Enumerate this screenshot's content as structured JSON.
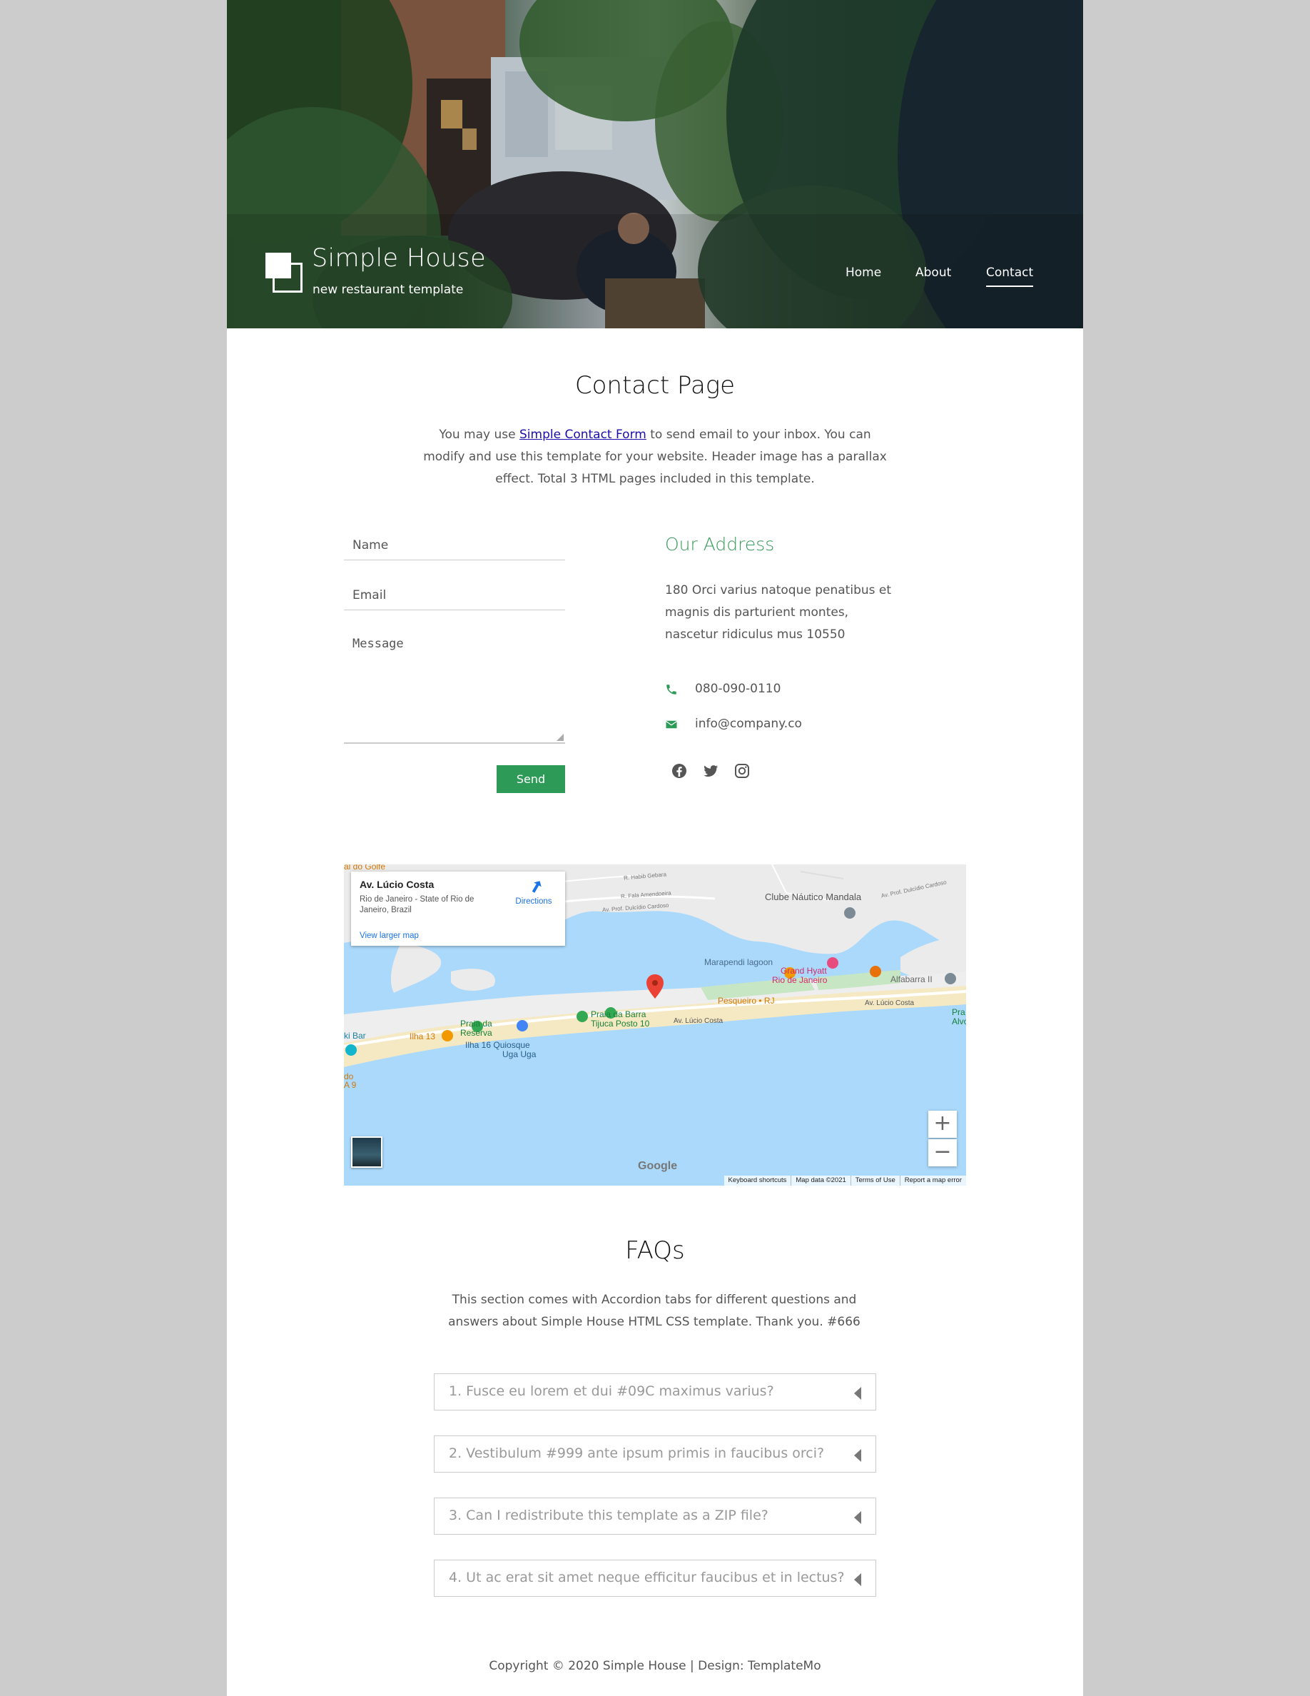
{
  "header": {
    "site_title": "Simple House",
    "site_subtitle": "new restaurant template",
    "nav": [
      {
        "label": "Home",
        "active": false
      },
      {
        "label": "About",
        "active": false
      },
      {
        "label": "Contact",
        "active": true
      }
    ]
  },
  "contact": {
    "title": "Contact Page",
    "intro_before_link": "You may use ",
    "intro_link": "Simple Contact Form",
    "intro_after_link": " to send email to your inbox. You can modify and use this template for your website. Header image has a parallax effect. Total 3 HTML pages included in this template.",
    "form": {
      "name_placeholder": "Name",
      "email_placeholder": "Email",
      "message_placeholder": "Message",
      "send_label": "Send"
    },
    "address": {
      "title": "Our Address",
      "text": "180 Orci varius natoque penatibus et magnis dis parturient montes, nascetur ridiculus mus 10550",
      "phone": "080-090-0110",
      "email": "info@company.co"
    },
    "social": [
      "facebook-icon",
      "twitter-icon",
      "instagram-icon"
    ],
    "colors": {
      "accent": "#2d9a58",
      "address_title": "#3a9a5c"
    }
  },
  "map": {
    "place_title": "Av. Lúcio Costa",
    "place_subtitle": "Rio de Janeiro - State of Rio de Janeiro, Brazil",
    "directions_label": "Directions",
    "larger_map_label": "View larger map",
    "google_label": "Google",
    "footer": [
      "Keyboard shortcuts",
      "Map data ©2021",
      "Terms of Use",
      "Report a map error"
    ],
    "labels": {
      "club": "Clube Náutico Mandala",
      "lagoon": "Marapendi lagoon",
      "hyatt_line1": "Grand Hyatt",
      "hyatt_line2": "Rio de Janeiro",
      "alfabarra": "Alfabarra II",
      "pesqueiro": "Pesqueiro • RJ",
      "praia_barra_line1": "Praia da Barra",
      "praia_barra_line2": "Tijuca Posto 10",
      "av_lucio_1": "Av. Lúcio Costa",
      "av_lucio_2": "Av. Lúcio Costa",
      "praia_reserva_line1": "Praia da",
      "praia_reserva_line2": "Reserva",
      "ilha13": "Ilha 13",
      "ilha16_line1": "Ilha 16 Quiosque",
      "ilha16_line2": "Uga Uga",
      "ki_bar": "ki Bar",
      "do": "do",
      "a9": "A 9",
      "golfe": "al do Golfe",
      "dulcidio_1": "Av. Prof. Dulcídio Cardoso",
      "dulcidio_2": "Av. Prof. Dulcídio Cardoso",
      "habib": "R. Habib Gebara",
      "fala": "R. Fala Amendoeira",
      "pra": "Pra",
      "alvo": "Alvo"
    }
  },
  "faq": {
    "title": "FAQs",
    "intro": "This section comes with Accordion tabs for different questions and answers about Simple House HTML CSS template. Thank you. #666",
    "items": [
      "1. Fusce eu lorem et dui #09C maximus varius?",
      "2. Vestibulum #999 ante ipsum primis in faucibus orci?",
      "3. Can I redistribute this template as a ZIP file?",
      "4. Ut ac erat sit amet neque efficitur faucibus et in lectus?"
    ]
  },
  "footer": {
    "text": "Copyright © 2020 Simple House | Design: TemplateMo"
  }
}
